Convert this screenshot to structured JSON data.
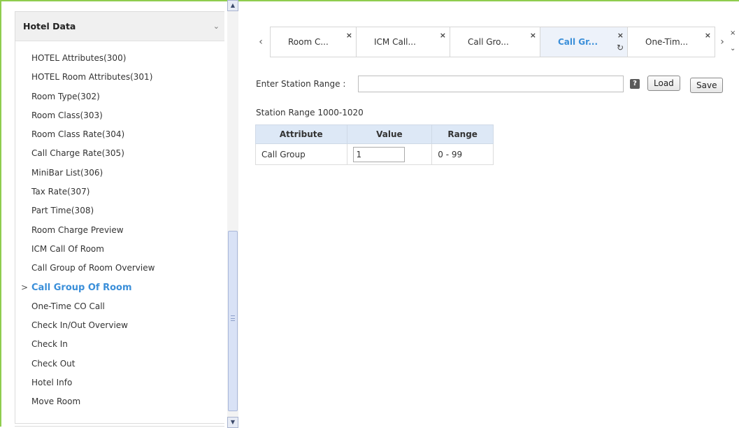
{
  "sidebar": {
    "title": "Hotel Data",
    "items": [
      {
        "label": "HOTEL Attributes(300)"
      },
      {
        "label": "HOTEL Room Attributes(301)"
      },
      {
        "label": "Room Type(302)"
      },
      {
        "label": "Room Class(303)"
      },
      {
        "label": "Room Class Rate(304)"
      },
      {
        "label": "Call Charge Rate(305)"
      },
      {
        "label": "MiniBar List(306)"
      },
      {
        "label": "Tax Rate(307)"
      },
      {
        "label": "Part Time(308)"
      },
      {
        "label": "Room Charge Preview"
      },
      {
        "label": "ICM Call Of Room"
      },
      {
        "label": "Call Group of Room Overview"
      },
      {
        "label": "Call Group Of Room",
        "active": true
      },
      {
        "label": "One-Time CO Call"
      },
      {
        "label": "Check In/Out Overview"
      },
      {
        "label": "Check In"
      },
      {
        "label": "Check Out"
      },
      {
        "label": "Hotel Info"
      },
      {
        "label": "Move Room"
      }
    ]
  },
  "tabs": [
    {
      "label": "Room C..."
    },
    {
      "label": "ICM Call..."
    },
    {
      "label": "Call Gro..."
    },
    {
      "label": "Call Gr...",
      "active": true
    },
    {
      "label": "One-Tim..."
    }
  ],
  "form": {
    "range_label": "Enter Station Range :",
    "range_value": "",
    "help": "?",
    "load_label": "Load",
    "save_label": "Save",
    "station_caption": "Station Range 1000-1020"
  },
  "table": {
    "headers": [
      "Attribute",
      "Value",
      "Range"
    ],
    "rows": [
      {
        "attribute": "Call Group",
        "value": "1",
        "range": "0 - 99"
      }
    ]
  },
  "icons": {
    "close": "×",
    "refresh": "↻",
    "prev": "‹",
    "next": "›"
  },
  "colors": {
    "frame_border": "#8fcd4e",
    "active_accent": "#3b8fd9",
    "table_header_bg": "#dde8f6"
  }
}
